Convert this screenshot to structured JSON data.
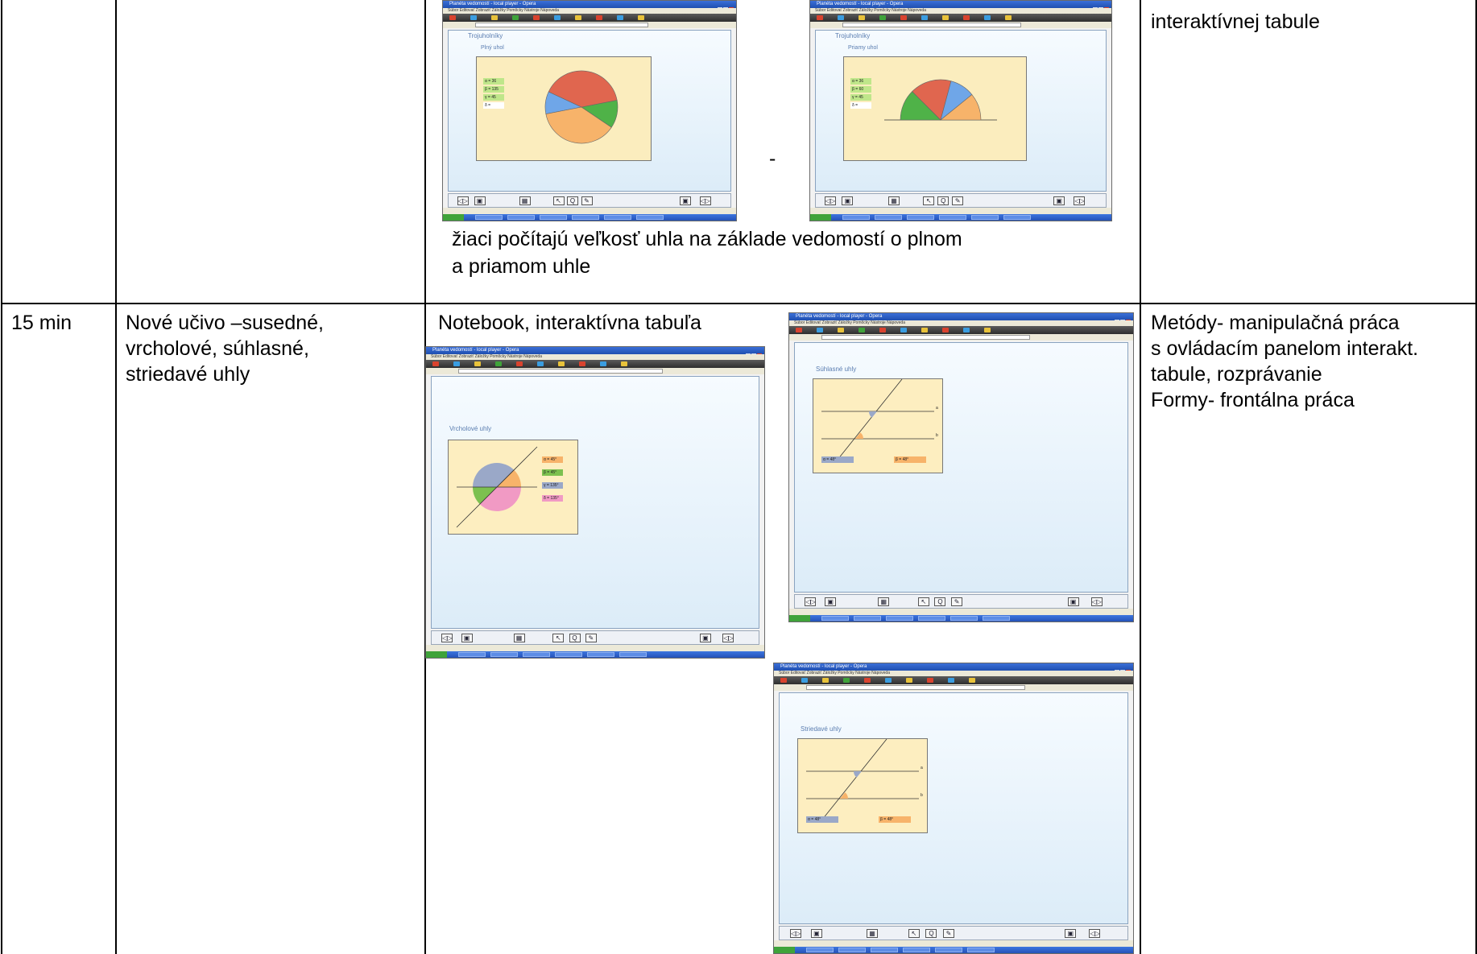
{
  "row1": {
    "dash": "-",
    "caption_line1": "žiaci počítajú veľkosť uhla na základe vedomostí o plnom",
    "caption_line2": "a priamom uhle",
    "col4_text": "interaktívnej tabule"
  },
  "row2": {
    "time": "15 min",
    "topic_lines": [
      "Nové učivo –susedné,",
      "vrcholové, súhlasné,",
      "striedavé uhly"
    ],
    "tools": "Notebook, interaktívna tabuľa",
    "methods_lines": [
      "Metódy- manipulačná práca",
      "s ovládacím panelom interakt.",
      "tabule, rozprávanie",
      "Formy- frontálna práca"
    ]
  },
  "screenshots": {
    "window_title": "Planéta vedomostí - local player - Opera",
    "menu": "Súbor  Editovať  Zobraziť  Záložky  Pomôcky  Nástroje  Nápoveda",
    "slide_full_angle": {
      "header": "Trojuholníky",
      "title": "Plný uhol",
      "labels": [
        "α = 36",
        "β = 135",
        "γ = 45",
        "δ ="
      ],
      "pie_values": [
        36,
        135,
        45,
        144
      ],
      "colors": [
        "#6fa6e8",
        "#f7b36a",
        "#4fb248",
        "#e0664f"
      ]
    },
    "slide_straight_angle": {
      "header": "Trojuholníky",
      "title": "Priamy uhol",
      "labels": [
        "α = 36",
        "β = 60",
        "γ = 45",
        "δ ="
      ],
      "pie_values": [
        45,
        60,
        36,
        39
      ],
      "colors": [
        "#4fb248",
        "#e0664f",
        "#6fa6e8",
        "#f7b36a"
      ]
    },
    "slide_vertical": {
      "title": "Vrcholové uhly",
      "labels": [
        "α = 45°",
        "β = 45°",
        "γ = 135°",
        "δ = 135°"
      ],
      "colors": [
        "#f7b36a",
        "#7cc04f",
        "#9aa8c8",
        "#f19ac4"
      ]
    },
    "slide_corresponding": {
      "title": "Súhlasné uhly",
      "labels": [
        "α = 48°",
        "β = 48°"
      ],
      "line_labels": [
        "a",
        "b"
      ]
    },
    "slide_alternate": {
      "title": "Striedavé uhly",
      "labels": [
        "α = 48°",
        "β = 48°"
      ],
      "line_labels": [
        "a",
        "b"
      ]
    },
    "ctrl_icons": [
      "◁▷",
      "▣",
      "▦",
      "↖",
      "Q",
      "✎",
      "▣",
      "◁▷"
    ]
  }
}
